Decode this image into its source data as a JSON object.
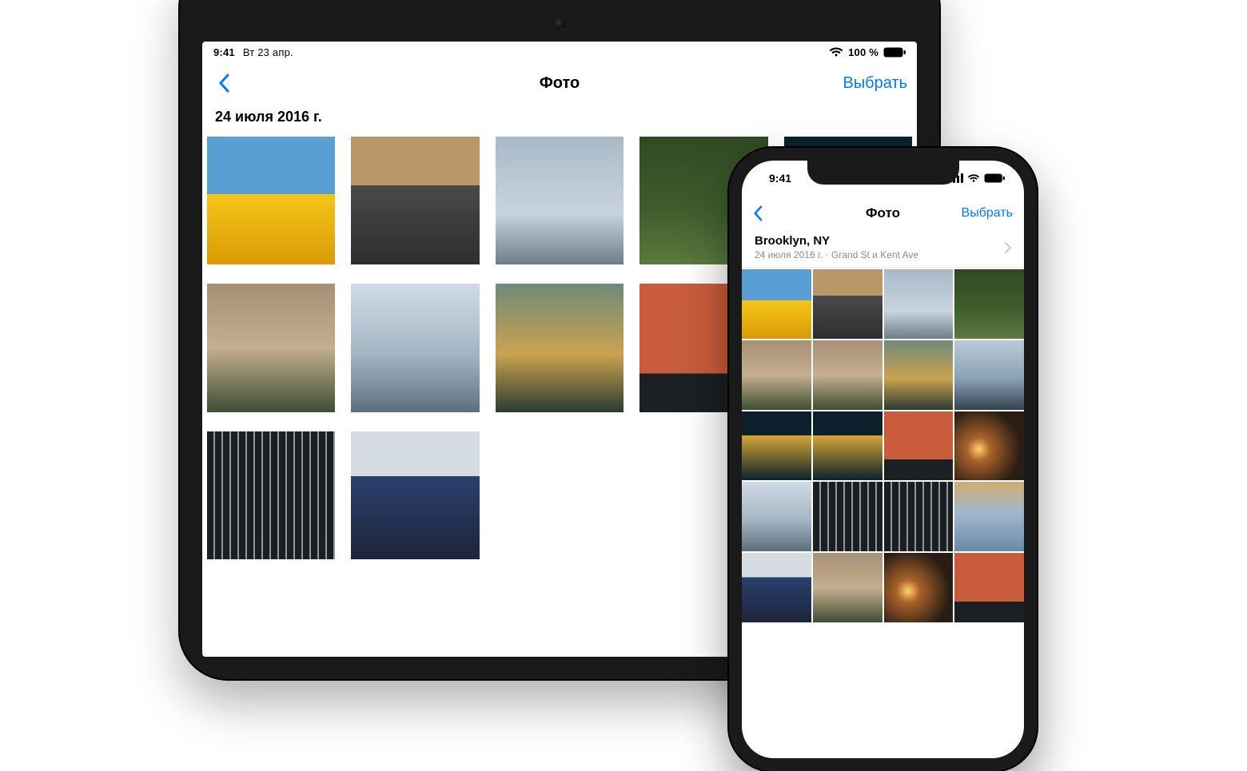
{
  "ipad": {
    "status": {
      "time": "9:41",
      "date": "Вт 23 апр.",
      "battery": "100 %"
    },
    "nav": {
      "title": "Фото",
      "select": "Выбрать"
    },
    "header": {
      "date": "24 июля 2016 г."
    },
    "thumbs": [
      "p-sunflower",
      "p-garage",
      "p-sunglasses",
      "p-trees",
      "p-yellowj",
      "p-curly",
      "p-skyline",
      "p-fence",
      "p-dancer",
      "p-sunset",
      "p-window",
      "p-bluej"
    ]
  },
  "iphone": {
    "status": {
      "time": "9:41"
    },
    "nav": {
      "title": "Фото",
      "select": "Выбрать"
    },
    "header": {
      "location": "Brooklyn, NY",
      "meta": "24 июля 2016 г.  ·  Grand St и Kent Ave"
    },
    "thumbs": [
      "p-sunflower",
      "p-garage",
      "p-sunglasses",
      "p-trees",
      "p-curly",
      "p-curly",
      "p-fence",
      "p-ferry",
      "p-yellowj",
      "p-yellowj",
      "p-dancer",
      "p-sunset",
      "p-skyline",
      "p-window",
      "p-window",
      "p-sky",
      "p-bluej",
      "p-curly",
      "p-sunset",
      "p-dancer"
    ]
  }
}
